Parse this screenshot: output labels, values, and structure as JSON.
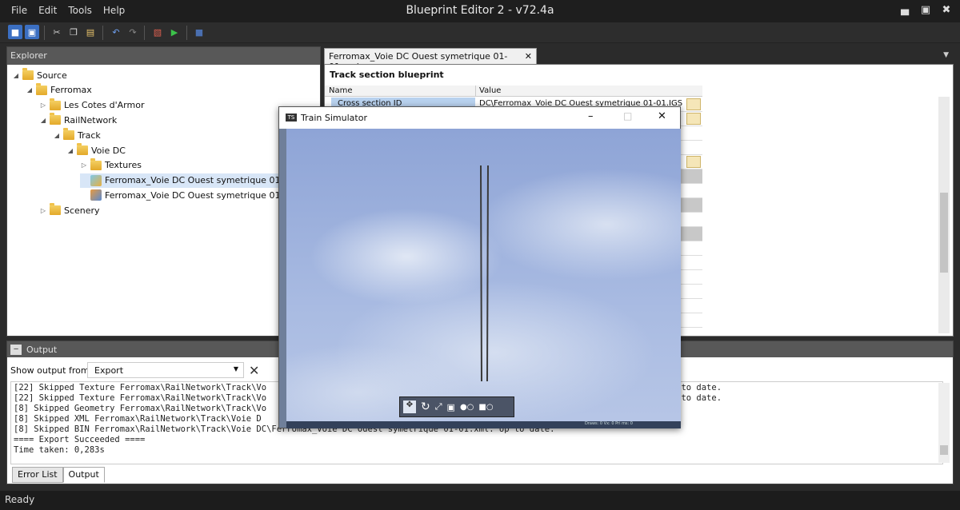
{
  "app": {
    "title": "Blueprint Editor 2 - v72.4a",
    "menu": [
      "File",
      "Edit",
      "Tools",
      "Help"
    ],
    "window_controls": [
      "minimize",
      "maximize",
      "close"
    ]
  },
  "toolbar": {
    "icons": [
      "save-icon",
      "save-all-icon",
      "cut-icon",
      "copy-icon",
      "paste-icon",
      "undo-icon",
      "redo-icon",
      "export-icon",
      "preview-run-icon",
      "stop-icon"
    ]
  },
  "explorer": {
    "title": "Explorer",
    "items": [
      {
        "label": "Source",
        "depth": 0,
        "expanded": true,
        "kind": "folder"
      },
      {
        "label": "Ferromax",
        "depth": 1,
        "expanded": true,
        "kind": "folder"
      },
      {
        "label": "Les Cotes d'Armor",
        "depth": 2,
        "expanded": false,
        "kind": "folder"
      },
      {
        "label": "RailNetwork",
        "depth": 2,
        "expanded": true,
        "kind": "folder"
      },
      {
        "label": "Track",
        "depth": 3,
        "expanded": true,
        "kind": "folder"
      },
      {
        "label": "Voie DC",
        "depth": 4,
        "expanded": true,
        "kind": "folder"
      },
      {
        "label": "Textures",
        "depth": 5,
        "expanded": false,
        "kind": "folder"
      },
      {
        "label": "Ferromax_Voie DC Ouest symetrique 01-01",
        "depth": 5,
        "kind": "blueprint",
        "selected": true
      },
      {
        "label": "Ferromax_Voie DC Ouest symetrique 01-01",
        "depth": 5,
        "kind": "geometry"
      },
      {
        "label": "Scenery",
        "depth": 2,
        "expanded": false,
        "kind": "folder"
      }
    ]
  },
  "editor": {
    "tab_label": "Ferromax_Voie DC Ouest symetrique 01-01.xml",
    "blueprint_title": "Track section blueprint",
    "columns": [
      "Name",
      "Value"
    ],
    "rows": [
      {
        "name": "Cross section ID",
        "value": "DC\\Ferromax_Voie DC Ouest symetrique 01-01.IGS"
      }
    ]
  },
  "output": {
    "title": "Output",
    "show_from_label": "Show output from:",
    "show_from_value": "Export",
    "lines": [
      "[22] Skipped Texture Ferromax\\RailNetwork\\Track\\Vo                                                                            e: Up to date.",
      "[22] Skipped Texture Ferromax\\RailNetwork\\Track\\Vo                                                                            e: Up to date.",
      "[8] Skipped Geometry Ferromax\\RailNetwork\\Track\\Vo",
      "[8] Skipped XML Ferromax\\RailNetwork\\Track\\Voie D",
      "[8] Skipped BIN Ferromax\\RailNetwork\\Track\\Voie DC\\Ferromax_Voie DC Ouest symetrique 01-01.xml: Up to date.",
      "==== Export Succeeded ====",
      "Time taken: 0,283s"
    ],
    "tabs": [
      "Error List",
      "Output"
    ],
    "active_tab": "Output"
  },
  "status": {
    "text": "Ready"
  },
  "train_simulator": {
    "title": "Train Simulator",
    "badge": "TS",
    "stats": "Draws: 0 Vx: 0 Pri ms: 0"
  }
}
